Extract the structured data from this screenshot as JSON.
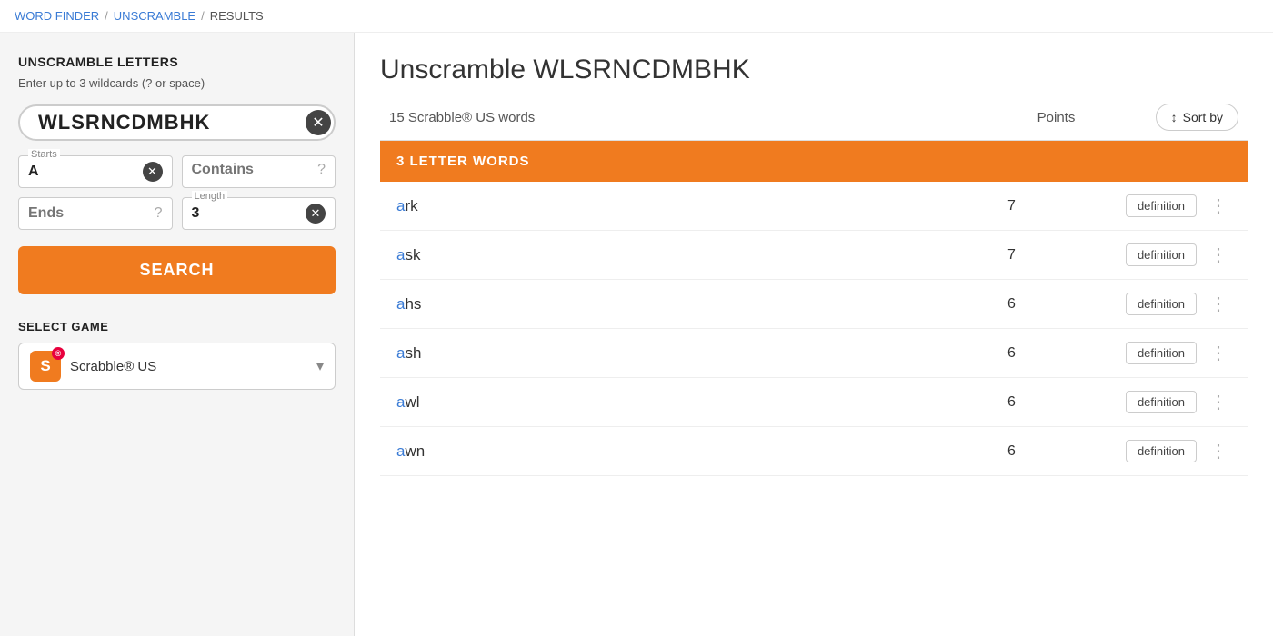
{
  "breadcrumb": {
    "items": [
      {
        "label": "WORD FINDER",
        "href": "#"
      },
      {
        "label": "UNSCRAMBLE",
        "href": "#"
      },
      {
        "label": "RESULTS",
        "href": null
      }
    ]
  },
  "sidebar": {
    "title": "UNSCRAMBLE LETTERS",
    "subtitle": "Enter up to 3 wildcards (? or space)",
    "letter_input": {
      "value": "WLSRNCDMBHK",
      "placeholder": "Enter letters..."
    },
    "starts_label": "Starts",
    "starts_value": "A",
    "contains_label": "Contains",
    "ends_label": "Ends",
    "length_label": "Length",
    "length_value": "3",
    "search_button": "SEARCH",
    "select_game_title": "SELECT GAME",
    "game_name": "Scrabble® US"
  },
  "results": {
    "title": "Unscramble WLSRNCDMBHK",
    "count_label": "15 Scrabble® US words",
    "points_col_label": "Points",
    "sort_by_label": "Sort by",
    "category_label": "3 LETTER WORDS",
    "words": [
      {
        "text": "ark",
        "first_letter": "a",
        "rest": "rk",
        "points": 7,
        "def_label": "definition"
      },
      {
        "text": "ask",
        "first_letter": "a",
        "rest": "sk",
        "points": 7,
        "def_label": "definition"
      },
      {
        "text": "ahs",
        "first_letter": "a",
        "rest": "hs",
        "points": 6,
        "def_label": "definition"
      },
      {
        "text": "ash",
        "first_letter": "a",
        "rest": "sh",
        "points": 6,
        "def_label": "definition"
      },
      {
        "text": "awl",
        "first_letter": "a",
        "rest": "wl",
        "points": 6,
        "def_label": "definition"
      },
      {
        "text": "awn",
        "first_letter": "a",
        "rest": "wn",
        "points": 6,
        "def_label": "definition"
      }
    ]
  }
}
